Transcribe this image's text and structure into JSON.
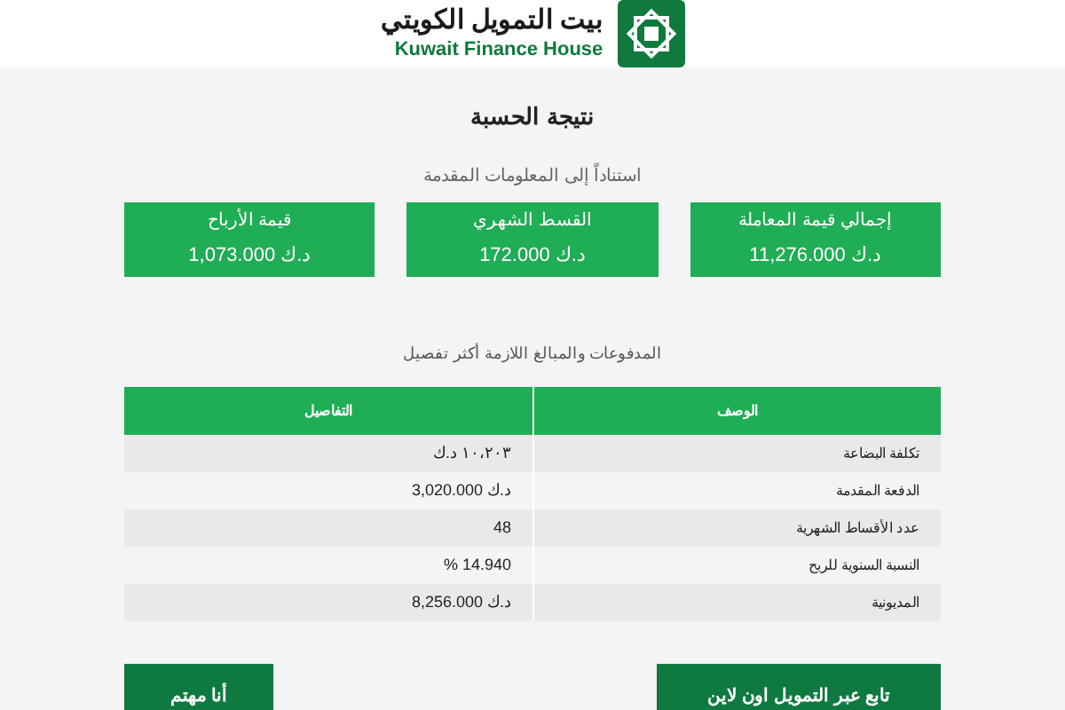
{
  "header": {
    "logo_arabic": "بيت التمويل الكويتي",
    "logo_english": "Kuwait Finance House"
  },
  "title": "نتيجة الحسبة",
  "subtitle": "استناداً إلى المعلومات المقدمة",
  "cards": [
    {
      "label": "إجمالي قيمة المعاملة",
      "value": "11,276.000 د.ك"
    },
    {
      "label": "القسط الشهري",
      "value": "172.000 د.ك"
    },
    {
      "label": "قيمة الأرباح",
      "value": "1,073.000 د.ك"
    }
  ],
  "table_caption": "المدفوعات والمبالغ اللازمة أكثر تفصيل",
  "table": {
    "columns": [
      "الوصف",
      "التفاصيل"
    ],
    "rows": [
      {
        "description": "تكلفة البضاعة",
        "details": "١٠،٢٠٣ د.ك"
      },
      {
        "description": "الدفعة المقدمة",
        "details": "3,020.000 د.ك"
      },
      {
        "description": "عدد الأقساط الشهرية",
        "details": "48"
      },
      {
        "description": "النسبة السنوية للربح",
        "details": "% 14.940"
      },
      {
        "description": "المديونية",
        "details": "8,256.000 د.ك"
      }
    ]
  },
  "buttons": [
    "تابع عبر التمويل اون لاين",
    "أنا مهتم"
  ]
}
